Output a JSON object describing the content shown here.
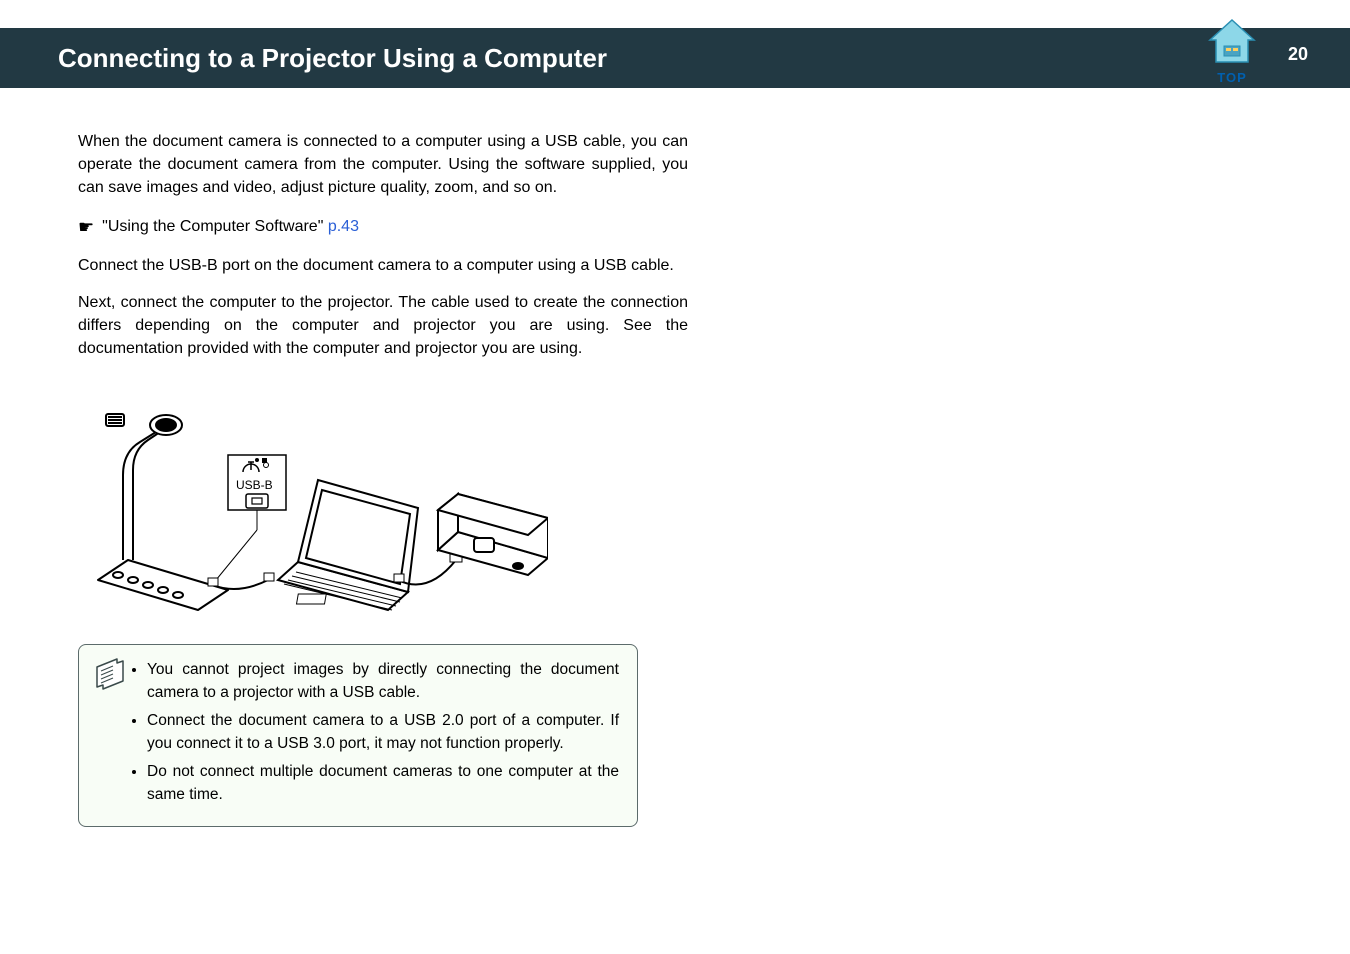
{
  "header": {
    "title": "Connecting to a Projector Using a Computer",
    "page": "20",
    "top_label": "TOP"
  },
  "body": {
    "p1": "When the document camera is connected to a computer using a USB cable, you can operate the document camera from the computer. Using the software supplied, you can save images and video, adjust picture quality, zoom, and so on.",
    "xref_text": "\"Using the Computer Software\" ",
    "xref_link": "p.43",
    "p2": "Connect the USB-B port on the document camera to a computer using a USB cable.",
    "p3": "Next, connect the computer to the projector. The cable used to create the connection differs depending on the computer and projector you are using. See the documentation provided with the computer and projector you are using.",
    "diagram_label": "USB-B"
  },
  "notes": {
    "n1": "You cannot project images by directly connecting the document camera to a projector with a USB cable.",
    "n2": "Connect the document camera to a USB 2.0 port of a computer. If you connect it to a USB 3.0 port, it may not function properly.",
    "n3": "Do not connect multiple document cameras to one computer at the same time."
  }
}
